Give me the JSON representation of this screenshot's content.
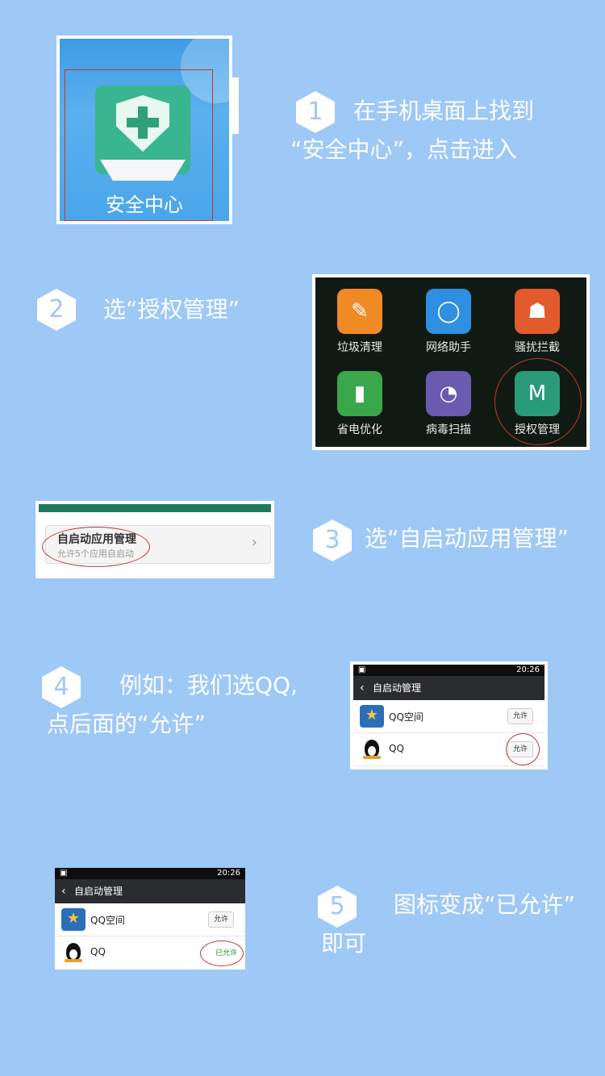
{
  "steps": [
    {
      "number": "1",
      "text_line1": "在手机桌面上找到",
      "text_line2": "“安全中心”，点击进入"
    },
    {
      "number": "2",
      "text_line1": "选“授权管理”"
    },
    {
      "number": "3",
      "text_line1": "选“自启动应用管理”"
    },
    {
      "number": "4",
      "text_line1": "例如：我们选QQ,",
      "text_line2": "点后面的“允许”"
    },
    {
      "number": "5",
      "text_line1": "图标变成“已允许”",
      "text_line2": "即可"
    }
  ],
  "screen1": {
    "app_label": "安全中心"
  },
  "screen2": {
    "tiles": [
      {
        "label": "垃圾清理",
        "color": "#f08a24"
      },
      {
        "label": "网络助手",
        "color": "#2f8fe0"
      },
      {
        "label": "骚扰拦截",
        "color": "#e35a2c"
      },
      {
        "label": "省电优化",
        "color": "#3aa84a"
      },
      {
        "label": "病毒扫描",
        "color": "#6a5bb0"
      },
      {
        "label": "授权管理",
        "color": "#2a9b78"
      }
    ]
  },
  "screen3": {
    "title": "自启动应用管理",
    "subtitle": "允许5个应用自启动"
  },
  "screen4": {
    "time": "20:26",
    "title": "自启动管理",
    "rows": [
      {
        "name": "QQ空间",
        "button": "允许"
      },
      {
        "name": "QQ",
        "button": "允许"
      }
    ]
  },
  "screen5": {
    "time": "20:26",
    "title": "自启动管理",
    "rows": [
      {
        "name": "QQ空间",
        "button": "允许"
      },
      {
        "name": "QQ",
        "status": "已允许"
      }
    ]
  }
}
